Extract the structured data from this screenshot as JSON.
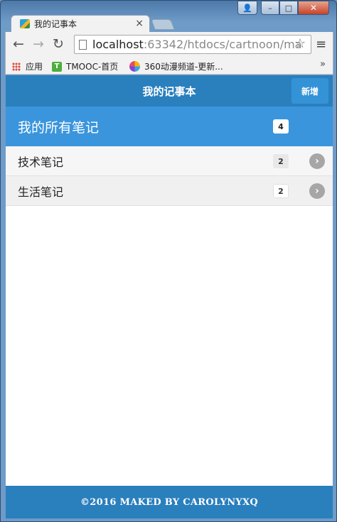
{
  "browser": {
    "tab_title": "我的记事本",
    "tab_close": "×",
    "url_host": "localhost",
    "url_rest": ":63342/htdocs/cartnoon/ma",
    "nav": {
      "back": "←",
      "forward": "→",
      "reload": "↻"
    },
    "star_icon": "☆",
    "menu_icon": "≡",
    "window_controls": {
      "user": "👤",
      "minimize": "–",
      "maximize": "□",
      "close": "✕"
    },
    "bookmarks": [
      {
        "label": "应用",
        "icon": "apps-icon"
      },
      {
        "label": "TMOOC-首页",
        "icon": "tmooc-icon",
        "icon_text": "T"
      },
      {
        "label": "360动漫频道-更新...",
        "icon": "360-icon"
      }
    ],
    "bookmarks_more": "»"
  },
  "app": {
    "header_title": "我的记事本",
    "add_button": "新增",
    "all_notes": {
      "label": "我的所有笔记",
      "count": "4"
    },
    "categories": [
      {
        "label": "技术笔记",
        "count": "2",
        "arrow": "›"
      },
      {
        "label": "生活笔记",
        "count": "2",
        "arrow": "›"
      }
    ],
    "footer": "©2016 MAKED BY CAROLYNYXQ"
  },
  "colors": {
    "header_bg": "#2a7fbd",
    "divider_bg": "#3a95dd",
    "add_button_bg": "#3493d6",
    "arrow_bg": "#a6a6a6"
  }
}
